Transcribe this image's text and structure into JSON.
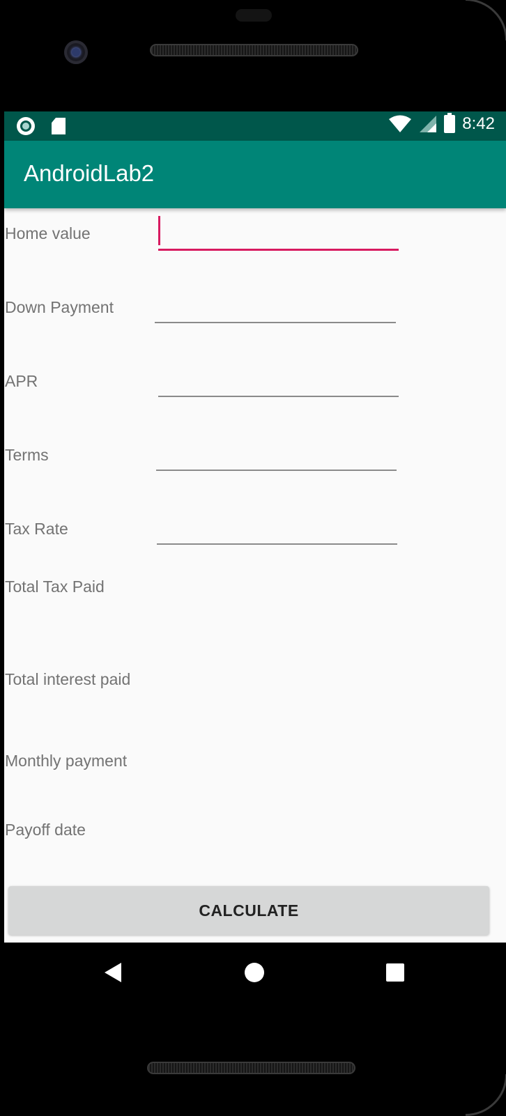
{
  "status_bar": {
    "time": "8:42",
    "icons_left": [
      "record-icon",
      "sd-card-icon"
    ],
    "icons_right": [
      "wifi-icon",
      "cell-signal-icon",
      "battery-icon"
    ]
  },
  "app_bar": {
    "title": "AndroidLab2"
  },
  "form": {
    "fields": [
      {
        "label": "Home value",
        "value": "",
        "focused": true
      },
      {
        "label": "Down Payment",
        "value": ""
      },
      {
        "label": "APR",
        "value": ""
      },
      {
        "label": "Terms",
        "value": ""
      },
      {
        "label": "Tax Rate",
        "value": ""
      }
    ],
    "outputs": [
      {
        "label": "Total Tax Paid"
      },
      {
        "label": "Total interest paid"
      },
      {
        "label": "Monthly payment"
      },
      {
        "label": "Payoff date"
      }
    ],
    "calculate_label": "CALCULATE"
  },
  "colors": {
    "status_bar": "#00574b",
    "app_bar": "#008577",
    "accent": "#d81b60",
    "background": "#fafafa"
  }
}
